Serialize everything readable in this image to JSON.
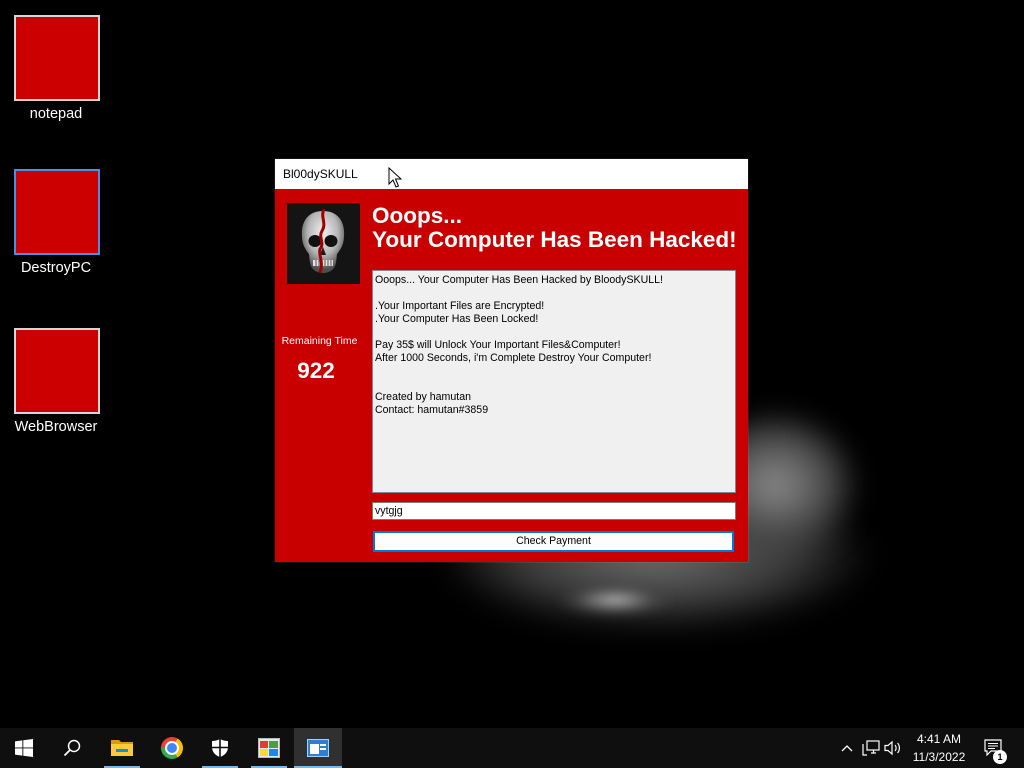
{
  "desktop": {
    "icons": [
      {
        "label": "notepad",
        "icon": "red-square-icon",
        "selected": false
      },
      {
        "label": "DestroyPC",
        "icon": "red-square-icon",
        "selected": true
      },
      {
        "label": "WebBrowser",
        "icon": "red-square-icon",
        "selected": false
      }
    ]
  },
  "window": {
    "title": "Bl00dySKULL",
    "image": "skull-image",
    "heading": [
      "Ooops...",
      "Your Computer Has Been Hacked!"
    ],
    "remaining_time": {
      "label": "Remaining Time",
      "value": "922"
    },
    "message_lines": [
      "Ooops... Your Computer Has Been Hacked by BloodySKULL!",
      "",
      ".Your Important Files are Encrypted!",
      ".Your Computer Has Been Locked!",
      "",
      "Pay 35$ will Unlock Your Important Files&Computer!",
      "After 1000 Seconds, i'm Complete Destroy Your Computer!",
      "",
      "",
      "Created by hamutan",
      "Contact: hamutan#3859"
    ],
    "input_value": "vytgjg",
    "button_label": "Check Payment"
  },
  "taskbar": {
    "start_icon": "windows-start-icon",
    "search_icon": "search-icon",
    "pinned": [
      {
        "icon": "file-explorer-icon",
        "running": true,
        "active": false
      },
      {
        "icon": "chrome-icon",
        "running": false,
        "active": false
      },
      {
        "icon": "windows-security-icon",
        "running": true,
        "active": false
      },
      {
        "icon": "app-window-icon",
        "running": true,
        "active": false
      },
      {
        "icon": "bloodyskull-app-icon",
        "running": true,
        "active": true
      }
    ],
    "tray_icons": [
      "chevron-up-icon",
      "network-icon",
      "volume-icon"
    ],
    "clock": {
      "time": "4:41 AM",
      "date": "11/3/2022"
    },
    "notifications": {
      "icon": "action-center-icon",
      "count": "1"
    }
  },
  "colors": {
    "window_body": "#c80000",
    "desktop_icon": "#cc0000",
    "focus_border": "#0078d7",
    "taskbar": "#0f0f0f",
    "running_indicator": "#76b9ed"
  }
}
